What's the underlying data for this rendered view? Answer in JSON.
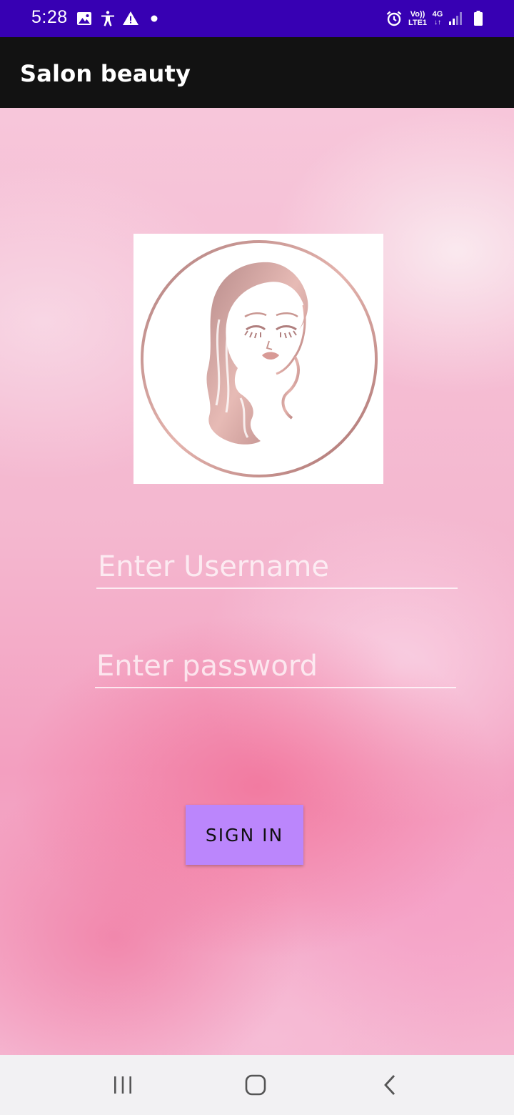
{
  "status_bar": {
    "time": "5:28",
    "network_top": "Vo))",
    "network_bottom": "LTE1",
    "signal_type": "4G",
    "icons": [
      "gallery-icon",
      "accessibility-icon",
      "warning-icon",
      "dot-icon",
      "alarm-icon",
      "signal-icon",
      "battery-icon"
    ]
  },
  "app_bar": {
    "title": "Salon beauty"
  },
  "login": {
    "username_placeholder": "Enter Username",
    "username_value": "",
    "password_placeholder": "Enter password",
    "password_value": "",
    "signin_label": "SIGN IN"
  },
  "nav_bar": {
    "icons": [
      "recent-apps-icon",
      "home-icon",
      "back-icon"
    ]
  },
  "colors": {
    "status_bar": "#3700b3",
    "app_bar": "#121212",
    "button": "#bb86fc",
    "logo_rose": "#c08f8c"
  }
}
